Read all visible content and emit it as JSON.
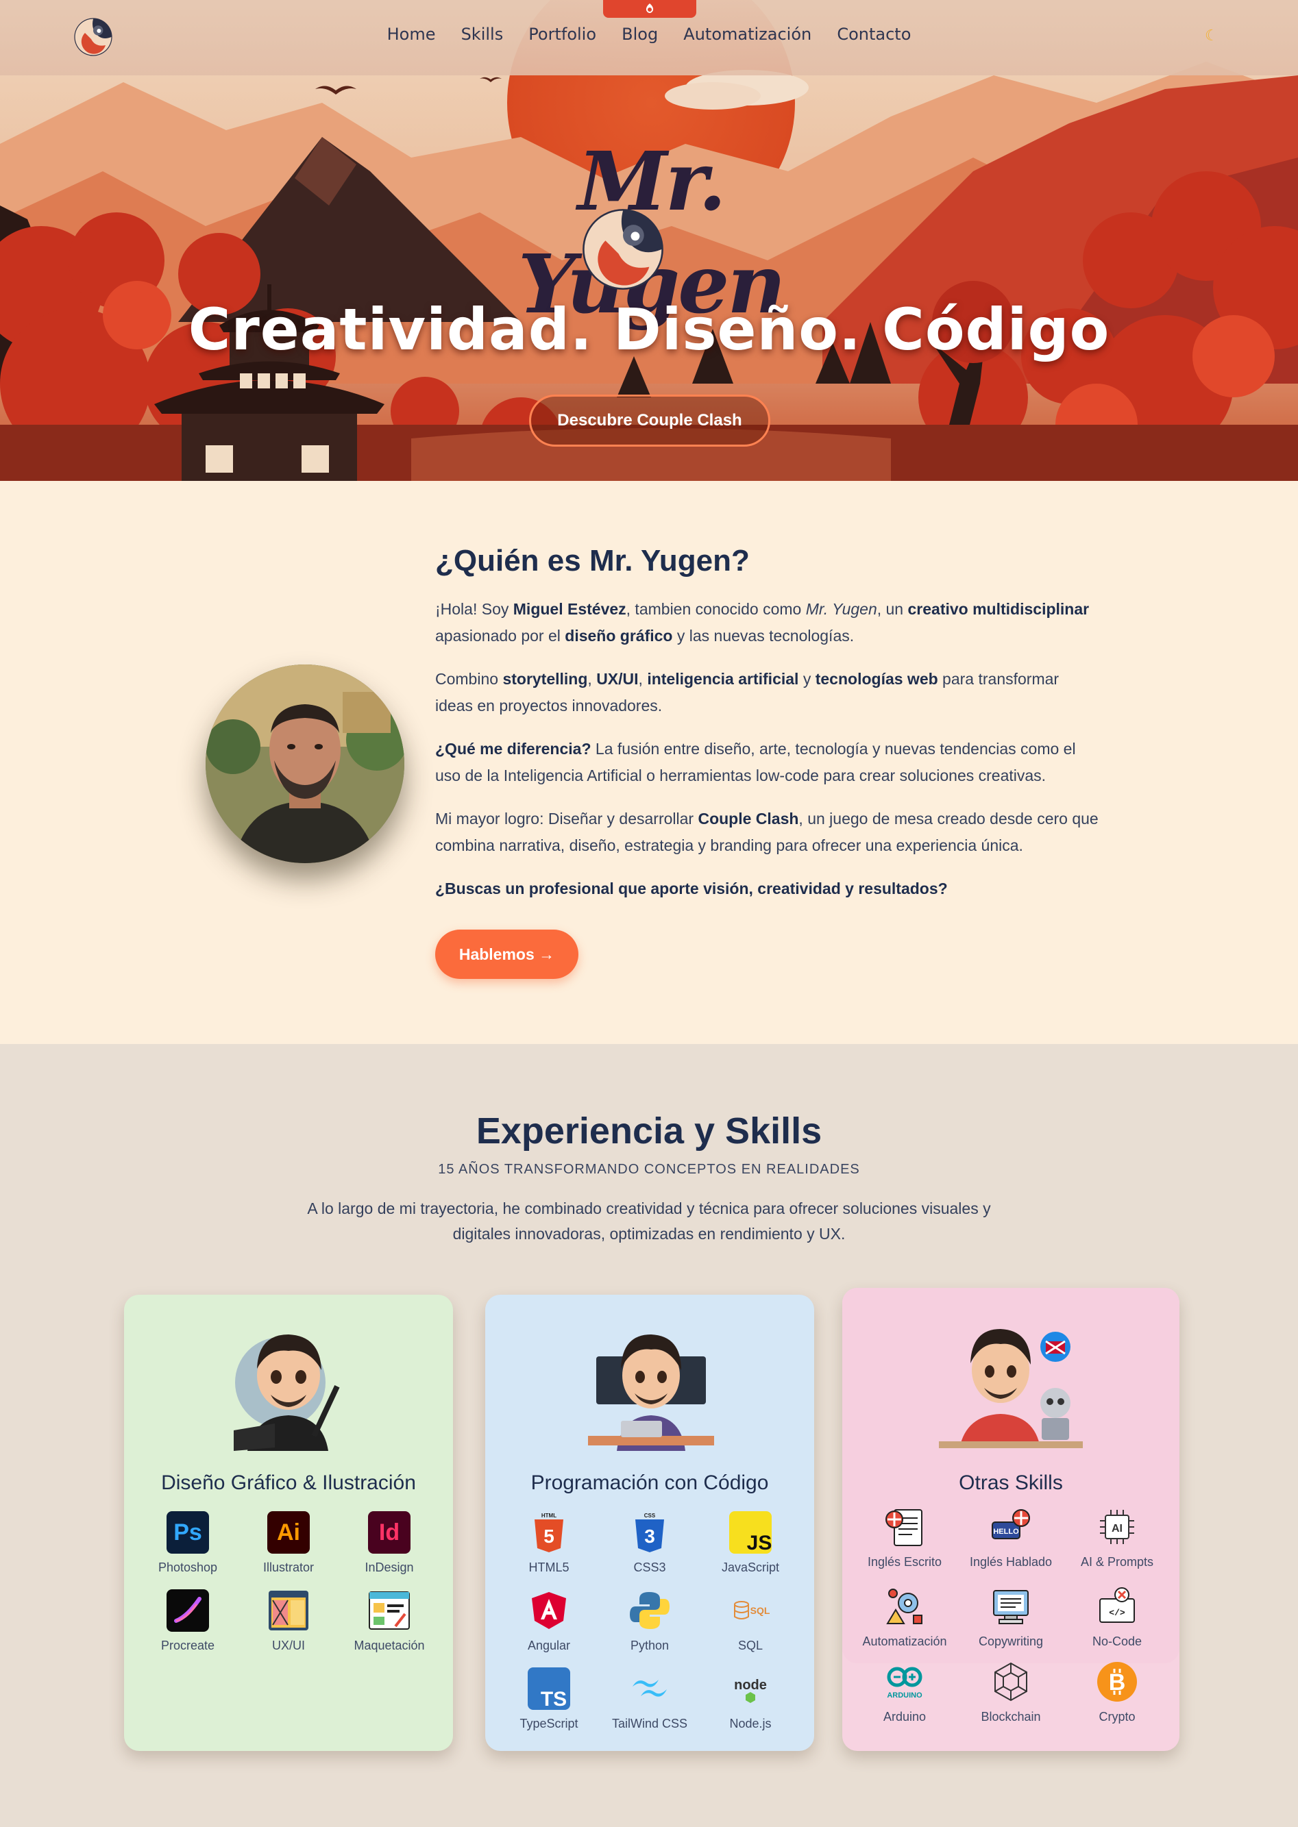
{
  "nav": {
    "items": [
      "Home",
      "Skills",
      "Portfolio",
      "Blog",
      "Automatización",
      "Contacto"
    ],
    "theme_icon": "moon-icon"
  },
  "hero": {
    "brand": "Mr. Yugen",
    "title": "Creatividad. Diseño. Código",
    "button": "Descubre Couple Clash"
  },
  "about": {
    "heading": "¿Quién es Mr. Yugen?",
    "p1": [
      {
        "t": "¡Hola! Soy "
      },
      {
        "t": "Miguel Estévez",
        "b": true
      },
      {
        "t": ", tambien conocido como "
      },
      {
        "t": "Mr. Yugen",
        "i": true
      },
      {
        "t": ", un "
      },
      {
        "t": "creativo multidisciplinar",
        "b": true
      },
      {
        "t": " apasionado por el "
      },
      {
        "t": "diseño gráfico",
        "b": true
      },
      {
        "t": " y las nuevas tecnologías."
      }
    ],
    "p2": [
      {
        "t": "Combino "
      },
      {
        "t": "storytelling",
        "b": true
      },
      {
        "t": ", "
      },
      {
        "t": "UX/UI",
        "b": true
      },
      {
        "t": ", "
      },
      {
        "t": "inteligencia artificial",
        "b": true
      },
      {
        "t": " y "
      },
      {
        "t": "tecnologías web",
        "b": true
      },
      {
        "t": " para transformar ideas en proyectos innovadores."
      }
    ],
    "p3": [
      {
        "t": "¿Qué me diferencia?",
        "b": true
      },
      {
        "t": " La fusión entre diseño, arte, tecnología y nuevas tendencias como el uso de la Inteligencia Artificial o herramientas low-code para crear soluciones creativas."
      }
    ],
    "p4": [
      {
        "t": "Mi mayor logro: Diseñar y desarrollar "
      },
      {
        "t": "Couple Clash",
        "b": true
      },
      {
        "t": ", un juego de mesa creado desde cero que combina narrativa, diseño, estrategia y branding para ofrecer una experiencia única."
      }
    ],
    "p5": [
      {
        "t": "¿Buscas un profesional que aporte visión, creatividad y resultados?",
        "b": true
      }
    ],
    "cta": "Hablemos →"
  },
  "skills": {
    "heading": "Experiencia y Skills",
    "subheading": "15 AÑOS TRANSFORMANDO CONCEPTOS EN REALIDADES",
    "intro": "A lo largo de mi trayectoria, he combinado creatividad y técnica para ofrecer soluciones visuales y digitales innovadoras, optimizadas en rendimiento y UX.",
    "cards": [
      {
        "title": "Diseño Gráfico & Ilustración",
        "color": "#ddf0d5",
        "tools": [
          {
            "label": "Photoshop",
            "icon": "photoshop-icon"
          },
          {
            "label": "Illustrator",
            "icon": "illustrator-icon"
          },
          {
            "label": "InDesign",
            "icon": "indesign-icon"
          },
          {
            "label": "Procreate",
            "icon": "procreate-icon"
          },
          {
            "label": "UX/UI",
            "icon": "ux-ui-icon"
          },
          {
            "label": "Maquetación",
            "icon": "layout-icon"
          }
        ]
      },
      {
        "title": "Programación con Código",
        "color": "#d5e7f6",
        "tools": [
          {
            "label": "HTML5",
            "icon": "html5-icon"
          },
          {
            "label": "CSS3",
            "icon": "css3-icon"
          },
          {
            "label": "JavaScript",
            "icon": "javascript-icon"
          },
          {
            "label": "Angular",
            "icon": "angular-icon"
          },
          {
            "label": "Python",
            "icon": "python-icon"
          },
          {
            "label": "SQL",
            "icon": "sql-icon"
          },
          {
            "label": "TypeScript",
            "icon": "typescript-icon"
          },
          {
            "label": "TailWind CSS",
            "icon": "tailwind-icon"
          },
          {
            "label": "Node.js",
            "icon": "nodejs-icon"
          }
        ]
      },
      {
        "title": "Otras Skills",
        "color": "#f7d3e1",
        "tools": [
          {
            "label": "Inglés Escrito",
            "icon": "written-english-icon"
          },
          {
            "label": "Inglés Hablado",
            "icon": "spoken-english-icon"
          },
          {
            "label": "AI & Prompts",
            "icon": "ai-chip-icon"
          },
          {
            "label": "Automatización",
            "icon": "automation-icon"
          },
          {
            "label": "Copywriting",
            "icon": "copywriting-icon"
          },
          {
            "label": "No-Code",
            "icon": "no-code-icon"
          },
          {
            "label": "Arduino",
            "icon": "arduino-icon"
          },
          {
            "label": "Blockchain",
            "icon": "blockchain-icon"
          },
          {
            "label": "Crypto",
            "icon": "bitcoin-icon"
          }
        ]
      }
    ]
  }
}
